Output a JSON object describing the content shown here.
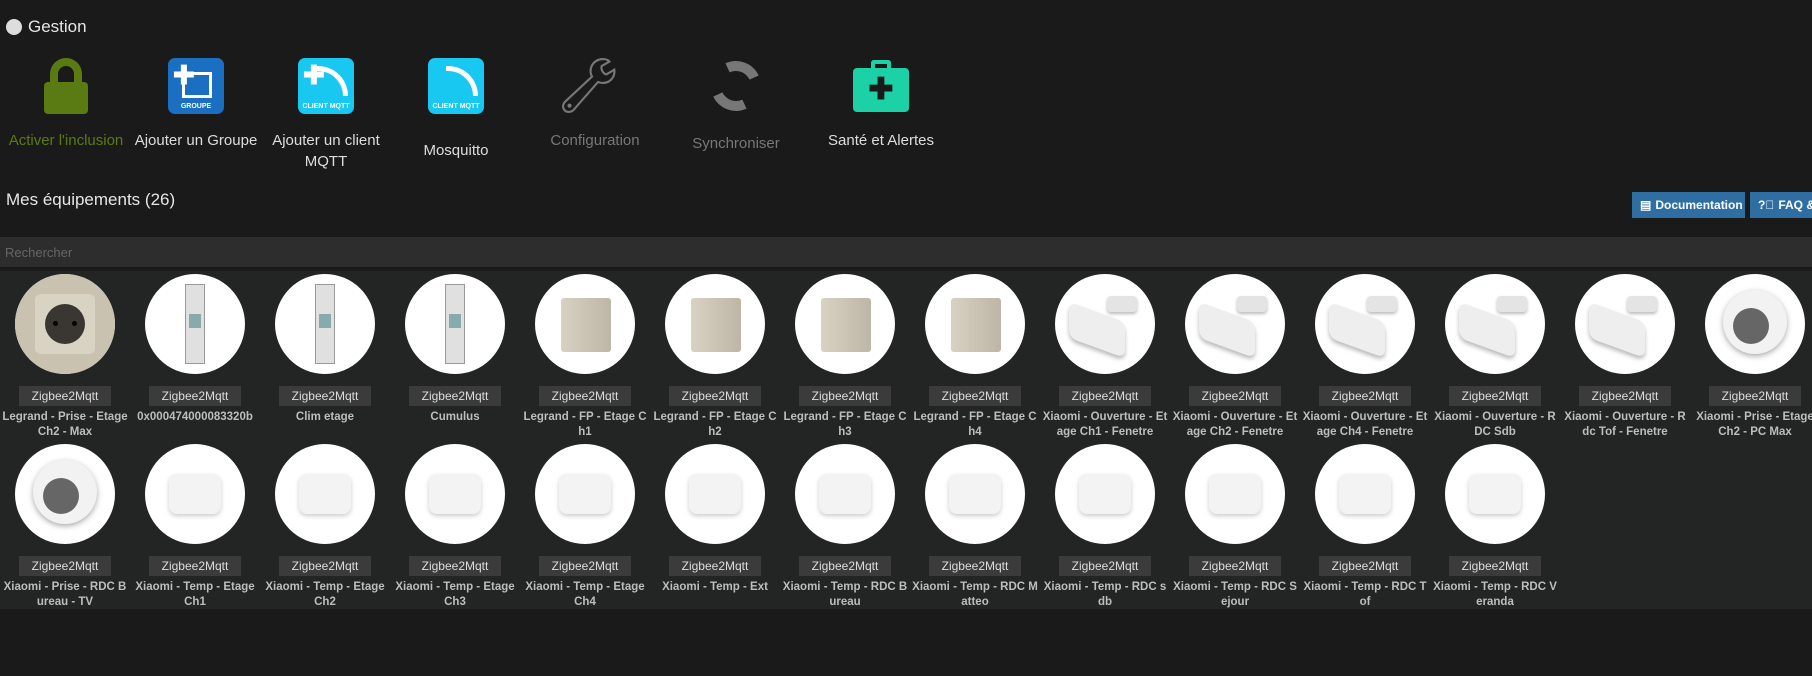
{
  "header": {
    "title": "Gestion",
    "icon": "gear-icon"
  },
  "actions": [
    {
      "id": "inclusion",
      "label": "Activer l'inclusion",
      "icon": "lock-icon",
      "color": "#5a7a13"
    },
    {
      "id": "add-group",
      "label": "Ajouter un Groupe",
      "icon": "groupe-icon",
      "color": "#e6e6e6"
    },
    {
      "id": "add-client",
      "label": "Ajouter un client MQTT",
      "icon": "client-mqtt-add-icon",
      "color": "#e6e6e6"
    },
    {
      "id": "mosquitto",
      "label": "Mosquitto",
      "icon": "client-mqtt-icon",
      "color": "#e6e6e6"
    },
    {
      "id": "configuration",
      "label": "Configuration",
      "icon": "wrench-icon",
      "color": "#777777"
    },
    {
      "id": "sync",
      "label": "Synchroniser",
      "icon": "sync-icon",
      "color": "#777777"
    },
    {
      "id": "health",
      "label": "Santé et Alertes",
      "icon": "medkit-icon",
      "color": "#e6e6e6"
    }
  ],
  "tile_text": {
    "groupe": "GROUPE",
    "client": "CLIENT MQTT"
  },
  "equipments": {
    "title": "Mes équipements (26)"
  },
  "buttons": {
    "documentation": "Documentation",
    "faq": "FAQ & Dépannage"
  },
  "search": {
    "placeholder": "Rechercher",
    "value": ""
  },
  "devices": [
    {
      "plugin": "Zigbee2Mqtt",
      "name": "Legrand - Prise - Etage Ch2 - Max",
      "image": "legrand-socket"
    },
    {
      "plugin": "Zigbee2Mqtt",
      "name": "0x000474000083320b",
      "image": "din-module"
    },
    {
      "plugin": "Zigbee2Mqtt",
      "name": "Clim etage",
      "image": "din-module"
    },
    {
      "plugin": "Zigbee2Mqtt",
      "name": "Cumulus",
      "image": "din-module"
    },
    {
      "plugin": "Zigbee2Mqtt",
      "name": "Legrand - FP - Etage Ch1",
      "image": "legrand-fp"
    },
    {
      "plugin": "Zigbee2Mqtt",
      "name": "Legrand - FP - Etage Ch2",
      "image": "legrand-fp"
    },
    {
      "plugin": "Zigbee2Mqtt",
      "name": "Legrand - FP - Etage Ch3",
      "image": "legrand-fp"
    },
    {
      "plugin": "Zigbee2Mqtt",
      "name": "Legrand - FP - Etage Ch4",
      "image": "legrand-fp"
    },
    {
      "plugin": "Zigbee2Mqtt",
      "name": "Xiaomi - Ouverture - Etage Ch1 - Fenetre",
      "image": "door-sensor"
    },
    {
      "plugin": "Zigbee2Mqtt",
      "name": "Xiaomi - Ouverture - Etage Ch2 - Fenetre",
      "image": "door-sensor"
    },
    {
      "plugin": "Zigbee2Mqtt",
      "name": "Xiaomi - Ouverture - Etage Ch4 - Fenetre",
      "image": "door-sensor"
    },
    {
      "plugin": "Zigbee2Mqtt",
      "name": "Xiaomi - Ouverture - RDC Sdb",
      "image": "door-sensor"
    },
    {
      "plugin": "Zigbee2Mqtt",
      "name": "Xiaomi - Ouverture - Rdc Tof - Fenetre",
      "image": "door-sensor"
    },
    {
      "plugin": "Zigbee2Mqtt",
      "name": "Xiaomi - Prise - Etage Ch2 - PC Max",
      "image": "smart-plug"
    },
    {
      "plugin": "Zigbee2Mqtt",
      "name": "Xiaomi - Prise - RDC Bureau - TV",
      "image": "smart-plug"
    },
    {
      "plugin": "Zigbee2Mqtt",
      "name": "Xiaomi - Temp - Etage Ch1",
      "image": "temp-sensor"
    },
    {
      "plugin": "Zigbee2Mqtt",
      "name": "Xiaomi - Temp - Etage Ch2",
      "image": "temp-sensor"
    },
    {
      "plugin": "Zigbee2Mqtt",
      "name": "Xiaomi - Temp - Etage Ch3",
      "image": "temp-sensor"
    },
    {
      "plugin": "Zigbee2Mqtt",
      "name": "Xiaomi - Temp - Etage Ch4",
      "image": "temp-sensor"
    },
    {
      "plugin": "Zigbee2Mqtt",
      "name": "Xiaomi - Temp - Ext",
      "image": "temp-sensor"
    },
    {
      "plugin": "Zigbee2Mqtt",
      "name": "Xiaomi - Temp - RDC Bureau",
      "image": "temp-sensor"
    },
    {
      "plugin": "Zigbee2Mqtt",
      "name": "Xiaomi - Temp - RDC Matteo",
      "image": "temp-sensor"
    },
    {
      "plugin": "Zigbee2Mqtt",
      "name": "Xiaomi - Temp - RDC sdb",
      "image": "temp-sensor"
    },
    {
      "plugin": "Zigbee2Mqtt",
      "name": "Xiaomi - Temp - RDC Sejour",
      "image": "temp-sensor"
    },
    {
      "plugin": "Zigbee2Mqtt",
      "name": "Xiaomi - Temp - RDC Tof",
      "image": "temp-sensor"
    },
    {
      "plugin": "Zigbee2Mqtt",
      "name": "Xiaomi - Temp - RDC Veranda",
      "image": "temp-sensor"
    }
  ]
}
